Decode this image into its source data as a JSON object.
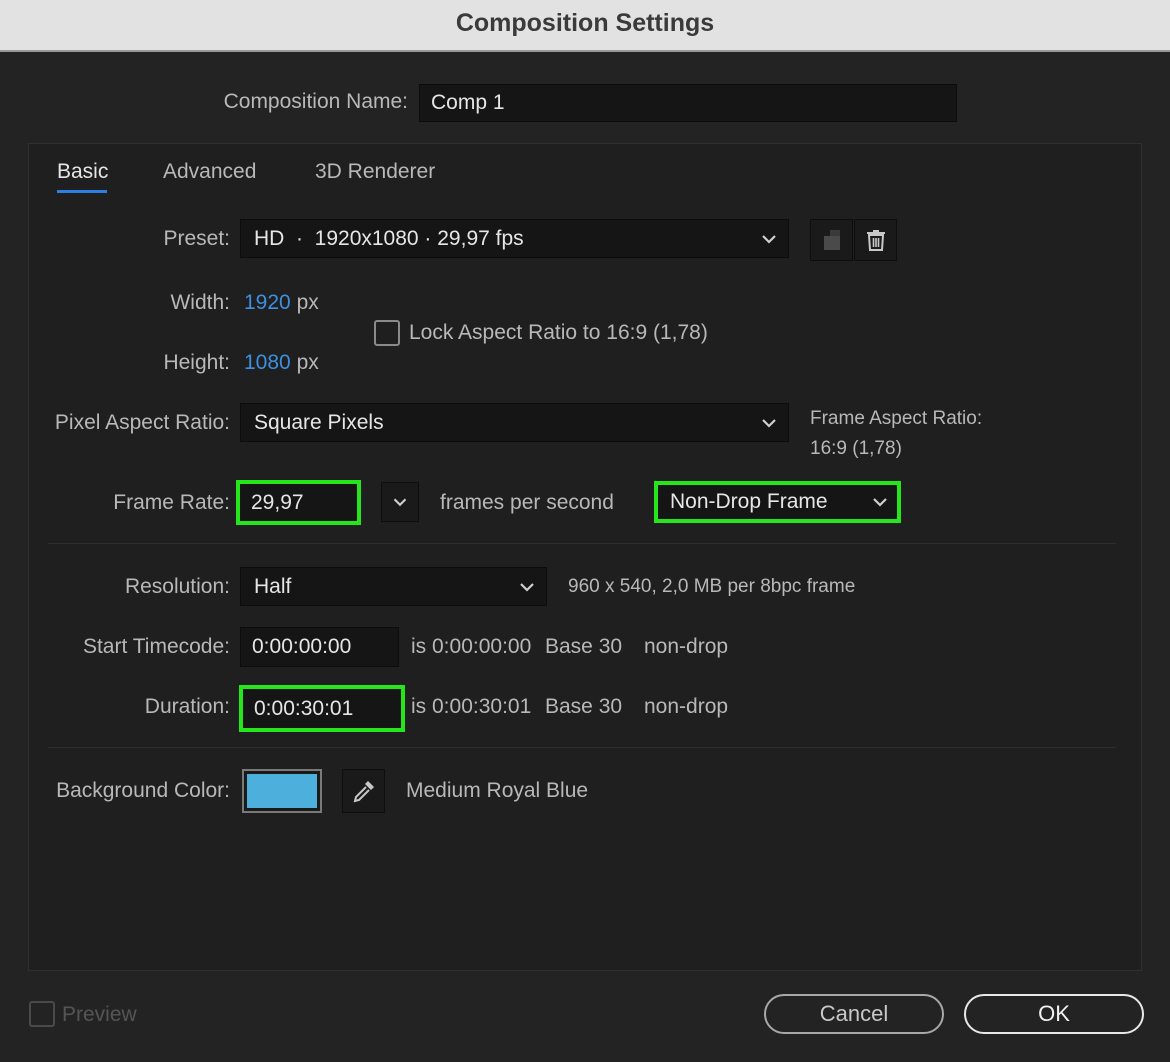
{
  "window": {
    "title": "Composition Settings"
  },
  "composition_name": {
    "label": "Composition Name:",
    "value": "Comp 1"
  },
  "tabs": [
    {
      "label": "Basic",
      "active": true
    },
    {
      "label": "Advanced",
      "active": false
    },
    {
      "label": "3D Renderer",
      "active": false
    }
  ],
  "preset": {
    "label": "Preset:",
    "value": "HD  ·  1920x1080 · 29,97 fps",
    "save_icon": "save-preset-icon",
    "delete_icon": "trash-icon"
  },
  "width": {
    "label": "Width:",
    "value": "1920",
    "unit": "px"
  },
  "height": {
    "label": "Height:",
    "value": "1080",
    "unit": "px"
  },
  "lock_aspect": {
    "label": "Lock Aspect Ratio to 16:9 (1,78)",
    "checked": false
  },
  "pixel_aspect": {
    "label": "Pixel Aspect Ratio:",
    "value": "Square Pixels"
  },
  "frame_aspect": {
    "label": "Frame Aspect Ratio:",
    "value": "16:9 (1,78)"
  },
  "frame_rate": {
    "label": "Frame Rate:",
    "value": "29,97",
    "unit": "frames per second",
    "drop_mode": "Non-Drop Frame"
  },
  "resolution": {
    "label": "Resolution:",
    "value": "Half",
    "info": "960 x 540, 2,0 MB per 8bpc frame"
  },
  "start_timecode": {
    "label": "Start Timecode:",
    "value": "0:00:00:00",
    "is_text": "is 0:00:00:00",
    "base": "Base 30",
    "mode": "non-drop"
  },
  "duration": {
    "label": "Duration:",
    "value": "0:00:30:01",
    "is_text": "is 0:00:30:01",
    "base": "Base 30",
    "mode": "non-drop"
  },
  "background_color": {
    "label": "Background Color:",
    "swatch": "#4db0dc",
    "name": "Medium Royal Blue",
    "eyedropper_icon": "eyedropper-icon"
  },
  "preview": {
    "label": "Preview",
    "checked": false
  },
  "buttons": {
    "cancel": "Cancel",
    "ok": "OK"
  },
  "colors": {
    "accent": "#2d7ee0",
    "highlight": "#25e61b",
    "link_value": "#3d8fe0"
  }
}
